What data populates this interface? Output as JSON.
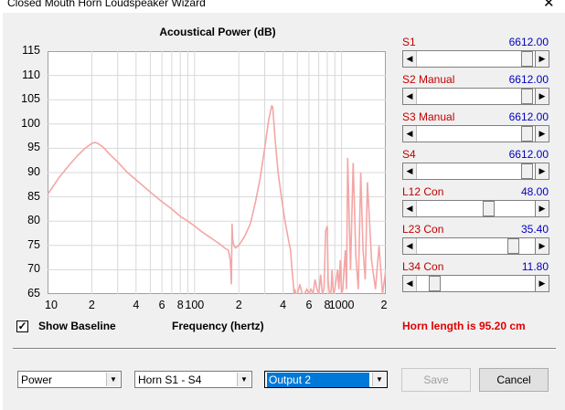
{
  "window": {
    "title": "Closed Mouth Horn Loudspeaker Wizard",
    "close_glyph": "✕"
  },
  "chart_data": {
    "type": "line",
    "title": "Acoustical Power (dB)",
    "xlabel": "Frequency (hertz)",
    "ylabel": "",
    "x_scale": "log",
    "xlim": [
      10,
      2000
    ],
    "ylim": [
      65,
      115
    ],
    "y_ticks": [
      "115",
      "110",
      "105",
      "100",
      "95",
      "90",
      "85",
      "80",
      "75",
      "70",
      "65"
    ],
    "x_tick_labels": [
      {
        "x": 10,
        "label": "10"
      },
      {
        "x": 20,
        "label": "2"
      },
      {
        "x": 40,
        "label": "4"
      },
      {
        "x": 60,
        "label": "6"
      },
      {
        "x": 80,
        "label": "8"
      },
      {
        "x": 100,
        "label": "100"
      },
      {
        "x": 200,
        "label": "2"
      },
      {
        "x": 400,
        "label": "4"
      },
      {
        "x": 600,
        "label": "6"
      },
      {
        "x": 800,
        "label": "8"
      },
      {
        "x": 1000,
        "label": "1000"
      },
      {
        "x": 2000,
        "label": "2"
      }
    ],
    "grid": true,
    "line_color": "#f4a6a6",
    "series": [
      {
        "x": [
          10,
          12,
          14,
          16,
          18,
          20,
          21,
          22,
          24,
          26,
          30,
          35,
          40,
          50,
          60,
          70,
          80,
          90,
          100,
          110,
          120,
          130,
          140,
          150,
          160,
          170,
          175,
          178,
          180,
          182,
          185,
          190,
          200,
          220,
          240,
          260,
          280,
          300,
          320,
          335,
          340,
          345,
          355,
          370,
          390,
          410,
          430,
          450,
          460,
          470,
          475,
          480,
          490,
          500,
          510,
          520,
          540,
          560,
          580,
          600,
          620,
          640,
          660,
          680,
          700,
          720,
          740,
          760,
          780,
          800,
          810,
          820,
          830,
          840,
          850,
          860,
          880,
          900,
          920,
          940,
          960,
          980,
          1000,
          1020,
          1040,
          1060,
          1080,
          1100,
          1150,
          1200,
          1250,
          1300,
          1350,
          1400,
          1450,
          1500,
          1600,
          1700,
          1800,
          1900,
          2000
        ],
        "y": [
          85.5,
          89,
          91.5,
          93.5,
          95,
          96,
          96.2,
          96,
          95.2,
          94,
          92.2,
          90,
          88.5,
          86,
          84,
          82.5,
          81,
          80,
          79,
          78,
          77.2,
          76.5,
          75.8,
          75.2,
          74.5,
          74,
          72,
          67,
          79.5,
          76,
          75,
          74.5,
          75,
          77,
          79.5,
          84,
          89,
          95,
          101,
          103.7,
          103.5,
          101,
          96,
          90,
          85,
          80.5,
          77,
          74,
          70,
          67,
          64,
          66,
          65,
          63,
          66,
          67,
          64,
          65,
          66,
          64,
          66,
          64,
          68,
          66,
          63,
          69,
          64,
          66,
          78,
          79,
          68,
          66,
          64,
          64,
          66,
          70,
          64,
          66,
          68,
          70,
          66,
          72,
          64,
          66,
          70,
          74,
          66,
          93,
          70,
          92,
          73,
          66,
          90,
          74,
          68,
          88,
          72,
          66,
          75,
          64,
          70
        ]
      }
    ]
  },
  "controls": {
    "show_baseline_label": "Show Baseline",
    "show_baseline_checked": true,
    "check_glyph": "✓",
    "horn_length_text": "Horn length is 95.20 cm"
  },
  "sliders": [
    {
      "label": "S1",
      "value": "6612.00",
      "position": 0.985
    },
    {
      "label": "S2 Manual",
      "value": "6612.00",
      "position": 0.985
    },
    {
      "label": "S3 Manual",
      "value": "6612.00",
      "position": 0.985
    },
    {
      "label": "S4",
      "value": "6612.00",
      "position": 0.985
    },
    {
      "label": "L12 Con",
      "value": "48.00",
      "position": 0.62
    },
    {
      "label": "L23 Con",
      "value": "35.40",
      "position": 0.85
    },
    {
      "label": "L34 Con",
      "value": "11.80",
      "position": 0.11
    }
  ],
  "footer": {
    "combo1": "Power",
    "combo2": "Horn S1 - S4",
    "combo3": "Output 2",
    "save_label": "Save",
    "cancel_label": "Cancel"
  },
  "icons": {
    "left_arrow": "◀",
    "right_arrow": "▶",
    "dropdown_arrow": "▼"
  },
  "colors": {
    "slider_label": "#c00000",
    "slider_value": "#0000c0",
    "horn_length": "#e00000",
    "selection": "#0078d7"
  }
}
